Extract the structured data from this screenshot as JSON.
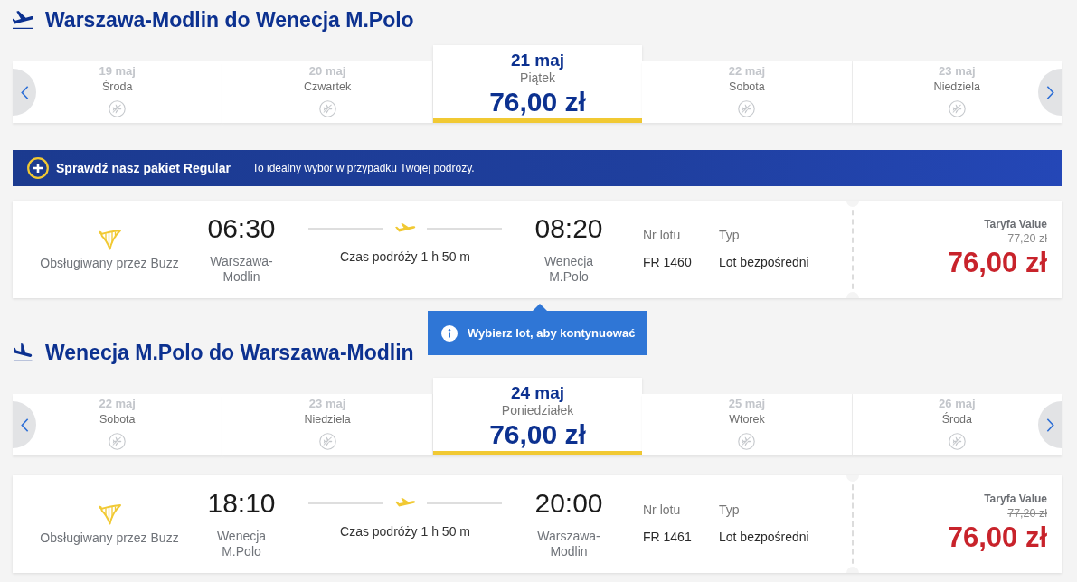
{
  "sections": [
    {
      "kind": "outbound",
      "title": "Warszawa-Modlin do Wenecja M.Polo",
      "dates": [
        {
          "date": "19 maj",
          "day": "Środa",
          "selected": false
        },
        {
          "date": "20 maj",
          "day": "Czwartek",
          "selected": false
        },
        {
          "date": "21 maj",
          "day": "Piątek",
          "price": "76,00 zł",
          "selected": true
        },
        {
          "date": "22 maj",
          "day": "Sobota",
          "selected": false
        },
        {
          "date": "23 maj",
          "day": "Niedziela",
          "selected": false
        }
      ],
      "banner": {
        "title": "Sprawdź nasz pakiet Regular",
        "text": "To idealny wybór w przypadku Twojej podróży."
      },
      "flight": {
        "operator": "Obsługiwany przez Buzz",
        "departure_time": "06:30",
        "departure_airport": "Warszawa-Modlin",
        "duration": "Czas podróży 1 h 50 m",
        "arrival_time": "08:20",
        "arrival_airport": "Wenecja M.Polo",
        "flight_number_label": "Nr lotu",
        "flight_number": "FR 1460",
        "type_label": "Typ",
        "type": "Lot bezpośredni",
        "fare_name": "Taryfa Value",
        "old_price": "77,20 zł",
        "price": "76,00 zł"
      },
      "tooltip": "Wybierz lot, aby kontynuować"
    },
    {
      "kind": "inbound",
      "title": "Wenecja M.Polo do Warszawa-Modlin",
      "dates": [
        {
          "date": "22 maj",
          "day": "Sobota",
          "selected": false
        },
        {
          "date": "23 maj",
          "day": "Niedziela",
          "selected": false
        },
        {
          "date": "24 maj",
          "day": "Poniedziałek",
          "price": "76,00 zł",
          "selected": true
        },
        {
          "date": "25 maj",
          "day": "Wtorek",
          "selected": false
        },
        {
          "date": "26 maj",
          "day": "Środa",
          "selected": false
        }
      ],
      "flight": {
        "operator": "Obsługiwany przez Buzz",
        "departure_time": "18:10",
        "departure_airport": "Wenecja M.Polo",
        "duration": "Czas podróży 1 h 50 m",
        "arrival_time": "20:00",
        "arrival_airport": "Warszawa-Modlin",
        "flight_number_label": "Nr lotu",
        "flight_number": "FR 1461",
        "type_label": "Typ",
        "type": "Lot bezpośredni",
        "fare_name": "Taryfa Value",
        "old_price": "77,20 zł",
        "price": "76,00 zł"
      }
    }
  ]
}
